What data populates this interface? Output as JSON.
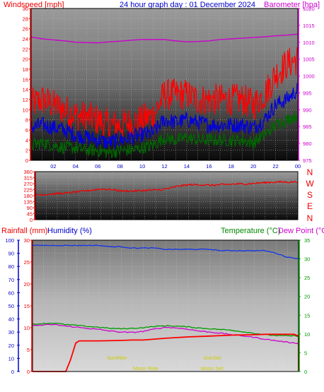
{
  "title": "24 hour graph day : 01 December 2024",
  "chart_data": [
    {
      "type": "line",
      "name": "wind-barometer",
      "left_axis_title": "Windspeed [mph]",
      "right_axis_title": "Barometer [hpa]",
      "x_ticks": [
        "02",
        "04",
        "06",
        "08",
        "10",
        "12",
        "14",
        "16",
        "18",
        "20",
        "22",
        "00"
      ],
      "y_left_ticks": [
        0,
        2,
        4,
        6,
        8,
        10,
        12,
        14,
        16,
        18,
        20,
        22,
        24,
        26,
        28,
        30
      ],
      "y_left_range": [
        0,
        30
      ],
      "y_right_ticks": [
        975,
        980,
        985,
        990,
        995,
        1000,
        1005,
        1010,
        1015,
        1020
      ],
      "y_right_range": [
        975,
        1020
      ],
      "x_range_hours": [
        0,
        24
      ],
      "series": [
        {
          "key": "barometer",
          "color": "#cc00cc",
          "axis": "right",
          "x": [
            0,
            1,
            2,
            3,
            4,
            5,
            6,
            7,
            8,
            9,
            10,
            11,
            12,
            13,
            14,
            15,
            16,
            17,
            18,
            19,
            20,
            21,
            22,
            23,
            24
          ],
          "values": [
            1011.5,
            1011.0,
            1010.7,
            1010.4,
            1010.0,
            1009.9,
            1009.8,
            1010.1,
            1010.3,
            1010.6,
            1010.8,
            1010.8,
            1010.8,
            1010.4,
            1010.1,
            1010.2,
            1010.4,
            1010.8,
            1011.0,
            1011.2,
            1011.4,
            1011.6,
            1011.9,
            1012.1,
            1012.4
          ]
        },
        {
          "key": "gust",
          "color": "#ff0000",
          "axis": "left",
          "x": [
            0,
            1,
            2,
            3,
            4,
            5,
            6,
            7,
            8,
            9,
            10,
            11,
            12,
            13,
            14,
            15,
            16,
            17,
            18,
            19,
            20,
            21,
            22,
            23,
            24
          ],
          "values": [
            11,
            12,
            11,
            10,
            9,
            8.5,
            8,
            7,
            7,
            7.5,
            8,
            9,
            13,
            13,
            13,
            12,
            12,
            12,
            12,
            12,
            11,
            13,
            17,
            19,
            20
          ]
        },
        {
          "key": "wind_avg",
          "color": "#0000dd",
          "axis": "left",
          "x": [
            0,
            1,
            2,
            3,
            4,
            5,
            6,
            7,
            8,
            9,
            10,
            11,
            12,
            13,
            14,
            15,
            16,
            17,
            18,
            19,
            20,
            21,
            22,
            23,
            24
          ],
          "values": [
            6.5,
            7,
            6.5,
            6,
            5,
            4.5,
            4,
            3.5,
            4,
            4.5,
            5,
            5.5,
            8,
            7.5,
            8,
            7.5,
            7,
            7,
            7,
            7,
            6.5,
            8,
            11,
            12,
            14
          ]
        },
        {
          "key": "wind_low",
          "color": "#006600",
          "axis": "left",
          "x": [
            0,
            1,
            2,
            3,
            4,
            5,
            6,
            7,
            8,
            9,
            10,
            11,
            12,
            13,
            14,
            15,
            16,
            17,
            18,
            19,
            20,
            21,
            22,
            23,
            24
          ],
          "values": [
            3,
            3.5,
            3,
            2.5,
            2.5,
            2,
            2,
            1.5,
            2,
            2,
            2.5,
            3,
            4.5,
            4,
            4.5,
            4,
            4,
            4,
            4,
            4,
            3.5,
            5,
            7,
            8,
            9
          ]
        }
      ]
    },
    {
      "type": "line",
      "name": "wind-direction",
      "y_left_ticks": [
        0,
        45,
        90,
        135,
        180,
        225,
        270,
        315,
        360
      ],
      "y_range": [
        0,
        360
      ],
      "direction_labels": [
        "N",
        "W",
        "S",
        "E",
        "N"
      ],
      "series": [
        {
          "key": "direction",
          "color": "#ee0000",
          "x": [
            0,
            1,
            2,
            3,
            4,
            5,
            6,
            7,
            8,
            9,
            10,
            11,
            12,
            13,
            14,
            15,
            16,
            17,
            18,
            19,
            20,
            21,
            22,
            23,
            24
          ],
          "values": [
            185,
            190,
            195,
            200,
            210,
            220,
            230,
            225,
            215,
            215,
            220,
            222,
            230,
            250,
            262,
            262,
            258,
            262,
            266,
            268,
            272,
            278,
            282,
            282,
            283
          ]
        }
      ]
    },
    {
      "type": "line",
      "name": "rain-humidity-temp",
      "left_axis_title_1": "Rainfall (mm)",
      "left_axis_title_2": "Humidity (%)",
      "right_axis_title_1": "Temperature (°C)",
      "right_axis_title_2": "Dew Point (°C)",
      "y_humidity_ticks": [
        0,
        10,
        20,
        30,
        40,
        50,
        60,
        70,
        80,
        90,
        100
      ],
      "humidity_range": [
        0,
        100
      ],
      "y_rain_ticks": [
        0,
        5,
        10,
        15,
        20,
        25,
        30
      ],
      "rain_range": [
        0,
        30
      ],
      "y_temp_ticks": [
        0,
        5,
        10,
        15,
        20,
        25,
        30,
        35
      ],
      "temp_range": [
        0,
        35
      ],
      "annotations": [
        {
          "text": "SunRise",
          "hour": 7.6,
          "level": "upper"
        },
        {
          "text": "SunSet",
          "hour": 16.2,
          "level": "upper"
        },
        {
          "text": "Moon Rise",
          "hour": 10.2,
          "level": "lower"
        },
        {
          "text": "Moon Set",
          "hour": 16.2,
          "level": "lower"
        }
      ],
      "series": [
        {
          "key": "humidity",
          "color": "#1133ee",
          "axis": "humidity",
          "x": [
            0,
            1,
            2,
            3,
            4,
            5,
            6,
            7,
            8,
            9,
            10,
            11,
            12,
            13,
            14,
            15,
            16,
            17,
            18,
            19,
            20,
            21,
            22,
            23,
            24
          ],
          "values": [
            96,
            96,
            96,
            96,
            96,
            96,
            96,
            95,
            95,
            94,
            94,
            94,
            93,
            93,
            93,
            93,
            93,
            92,
            92,
            92,
            92,
            92,
            90,
            87,
            86
          ]
        },
        {
          "key": "temperature",
          "color": "#009900",
          "axis": "temp",
          "x": [
            0,
            1,
            2,
            3,
            4,
            5,
            6,
            7,
            8,
            9,
            10,
            11,
            12,
            13,
            14,
            15,
            16,
            17,
            18,
            19,
            20,
            21,
            22,
            23,
            24
          ],
          "values": [
            12.6,
            12.8,
            12.9,
            12.5,
            12.3,
            12.0,
            11.8,
            11.5,
            11.4,
            11.5,
            11.7,
            12.0,
            12.2,
            12.1,
            11.9,
            11.6,
            11.4,
            11.2,
            11.0,
            10.6,
            10.2,
            9.8,
            9.6,
            9.5,
            9.5
          ]
        },
        {
          "key": "dewpoint",
          "color": "#cc00cc",
          "axis": "temp",
          "x": [
            0,
            1,
            2,
            3,
            4,
            5,
            6,
            7,
            8,
            9,
            10,
            11,
            12,
            13,
            14,
            15,
            16,
            17,
            18,
            19,
            20,
            21,
            22,
            23,
            24
          ],
          "values": [
            12.2,
            12.4,
            12.5,
            12.1,
            11.8,
            11.5,
            11.2,
            10.8,
            10.5,
            10.4,
            10.7,
            11.3,
            11.8,
            11.6,
            11.3,
            10.8,
            10.5,
            10.2,
            9.8,
            9.5,
            9.1,
            8.6,
            8.2,
            7.8,
            7.5
          ]
        },
        {
          "key": "rainfall",
          "color": "#ff0000",
          "axis": "rain",
          "x": [
            0,
            3,
            3.4,
            3.9,
            4.2,
            6,
            8,
            9,
            10,
            11,
            12,
            14,
            16,
            18,
            20,
            21,
            22,
            23,
            23.6,
            23.9,
            24,
            24
          ],
          "values": [
            0,
            0,
            2.5,
            6.5,
            7,
            7,
            7.1,
            7.2,
            7.2,
            7.4,
            7.6,
            7.9,
            8.1,
            8.3,
            8.4,
            8.5,
            8.5,
            8.5,
            8.5,
            8.2,
            8.2,
            0
          ]
        }
      ]
    }
  ]
}
